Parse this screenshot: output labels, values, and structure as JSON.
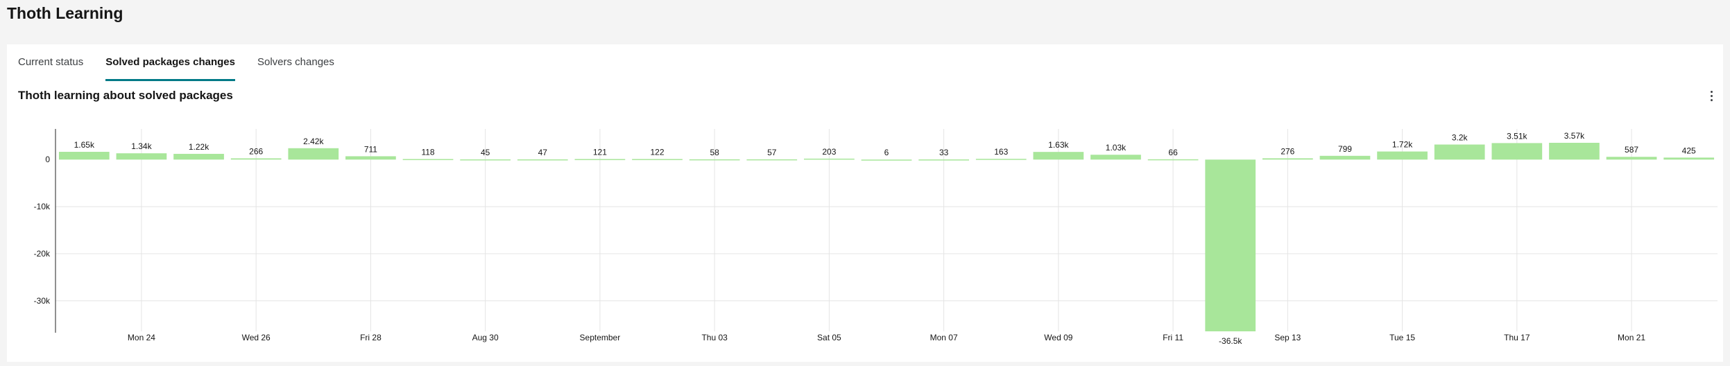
{
  "app": {
    "title": "Thoth Learning"
  },
  "tabs": [
    {
      "label": "Current status",
      "active": false
    },
    {
      "label": "Solved packages changes",
      "active": true
    },
    {
      "label": "Solvers changes",
      "active": false
    }
  ],
  "card": {
    "title": "Thoth learning about solved packages",
    "menu_icon": "kebab-vertical-icon"
  },
  "colors": {
    "bar": "#a8e69a",
    "active_tab": "#007a87",
    "grid": "#e4e4e4",
    "axis": "#222222"
  },
  "chart_data": {
    "type": "bar",
    "title": "Thoth learning about solved packages",
    "values": [
      1650,
      1340,
      1220,
      266,
      2420,
      711,
      118,
      45,
      47,
      121,
      122,
      58,
      57,
      203,
      6,
      33,
      163,
      1630,
      1030,
      66,
      -36500,
      276,
      799,
      1720,
      3200,
      3510,
      3570,
      587,
      425
    ],
    "value_labels": [
      "1.65k",
      "1.34k",
      "1.22k",
      "266",
      "2.42k",
      "711",
      "118",
      "45",
      "47",
      "121",
      "122",
      "58",
      "57",
      "203",
      "6",
      "33",
      "163",
      "1.63k",
      "1.03k",
      "66",
      "-36.5k",
      "276",
      "799",
      "1.72k",
      "3.2k",
      "3.51k",
      "3.57k",
      "587",
      "425"
    ],
    "x_tick_labels": [
      "Mon 24",
      "Wed 26",
      "Fri 28",
      "Aug 30",
      "September",
      "Thu 03",
      "Sat 05",
      "Mon 07",
      "Wed 09",
      "Fri 11",
      "Sep 13",
      "Tue 15",
      "Thu 17",
      "Mon 21"
    ],
    "x_tick_positions": [
      1.5,
      3.5,
      5.5,
      7.5,
      9.5,
      11.5,
      13.5,
      15.5,
      17.5,
      19.5,
      21.5,
      23.5,
      25.5,
      27.5
    ],
    "y_ticks": [
      0,
      -10000,
      -20000,
      -30000
    ],
    "y_tick_labels": [
      "0",
      "-10k",
      "-20k",
      "-30k"
    ],
    "ylim": [
      -36500,
      3570
    ],
    "grid": true,
    "legend": "none"
  }
}
